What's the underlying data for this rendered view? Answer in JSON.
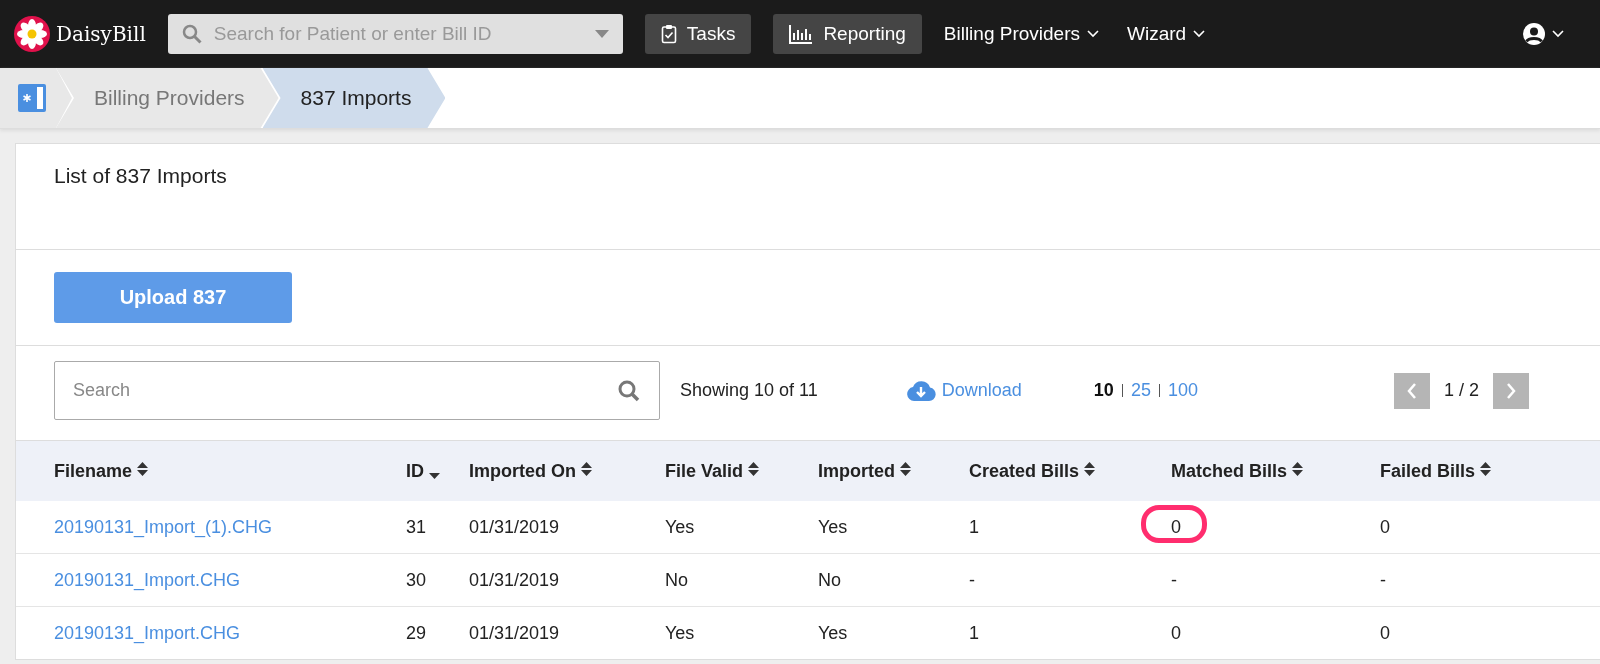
{
  "topbar": {
    "logo": "DaisyBill",
    "search": {
      "placeholder": "Search for Patient or enter Bill ID"
    },
    "nav": [
      {
        "label": "Tasks",
        "kind": "button"
      },
      {
        "label": "Reporting",
        "kind": "button"
      },
      {
        "label": "Billing Providers",
        "kind": "menu"
      },
      {
        "label": "Wizard",
        "kind": "menu"
      }
    ]
  },
  "breadcrumb": [
    {
      "label": "Billing Providers",
      "selected": false
    },
    {
      "label": "837 Imports",
      "selected": true
    }
  ],
  "card": {
    "title": "List of 837 Imports",
    "upload_button": "Upload 837",
    "search": {
      "placeholder": "Search"
    },
    "showing": "Showing 10 of 11",
    "download": "Download",
    "page_sizes": [
      {
        "label": "10",
        "selected": true
      },
      {
        "label": "25",
        "selected": false
      },
      {
        "label": "100",
        "selected": false
      }
    ],
    "page": "1 / 2"
  },
  "table": {
    "columns": [
      {
        "label": "Filename",
        "sorted_desc": false
      },
      {
        "label": "ID",
        "sorted_desc": true
      },
      {
        "label": "Imported On",
        "sorted_desc": false
      },
      {
        "label": "File Valid",
        "sorted_desc": false
      },
      {
        "label": "Imported",
        "sorted_desc": false
      },
      {
        "label": "Created Bills",
        "sorted_desc": false
      },
      {
        "label": "Matched Bills",
        "sorted_desc": false
      },
      {
        "label": "Failed Bills",
        "sorted_desc": false
      }
    ],
    "rows": [
      {
        "cells": [
          "20190131_Import_(1).CHG",
          "31",
          "01/31/2019",
          "Yes",
          "Yes",
          "1",
          "0",
          "0"
        ],
        "matched_highlighted": true
      },
      {
        "cells": [
          "20190131_Import.CHG",
          "30",
          "01/31/2019",
          "No",
          "No",
          "-",
          "-",
          "-"
        ],
        "matched_highlighted": false
      },
      {
        "cells": [
          "20190131_Import.CHG",
          "29",
          "01/31/2019",
          "Yes",
          "Yes",
          "1",
          "0",
          "0"
        ],
        "matched_highlighted": false
      }
    ]
  }
}
